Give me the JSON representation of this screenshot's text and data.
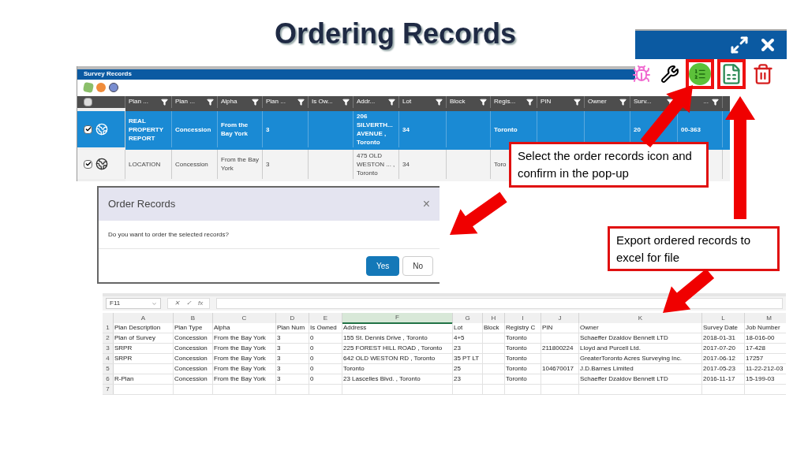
{
  "slide_title": "Ordering Records",
  "survey_records": {
    "title": "Survey Records",
    "header_checked": false,
    "columns": [
      "Plan ...",
      "Plan ...",
      "Alpha",
      "Plan ...",
      "Is Ow...",
      "Addr...",
      "Lot",
      "Block",
      "Regis...",
      "PIN",
      "Owner",
      "Surv...",
      "..."
    ],
    "rows": [
      {
        "selected": true,
        "checked": true,
        "cells": [
          "REAL PROPERTY REPORT",
          "Concession",
          "From the Bay York",
          "3",
          "",
          "206 SILVERTH... AVENUE , Toronto",
          "34",
          "",
          "Toronto",
          "",
          "",
          "20",
          "00-363"
        ]
      },
      {
        "selected": false,
        "checked": true,
        "cells": [
          "LOCATION",
          "Concession",
          "From the Bay York",
          "3",
          "",
          "475 OLD WESTON ... , Toronto",
          "34",
          "",
          "Toro",
          "",
          "",
          "",
          ""
        ]
      }
    ]
  },
  "toolbar": {
    "buttons": [
      {
        "kind": "bug",
        "highlighted": false
      },
      {
        "kind": "wrench",
        "highlighted": false
      },
      {
        "kind": "order",
        "highlighted": true
      },
      {
        "kind": "excel",
        "highlighted": true
      },
      {
        "kind": "trash",
        "highlighted": false
      }
    ]
  },
  "callouts": [
    {
      "text": "Select the order records icon and confirm in the pop-up"
    },
    {
      "text": "Export ordered records to excel for file"
    }
  ],
  "dialog": {
    "title": "Order Records",
    "close": "×",
    "message": "Do you want to order the selected records?",
    "buttons": [
      {
        "label": "Yes",
        "primary": true
      },
      {
        "label": "No",
        "primary": false
      }
    ]
  },
  "spreadsheet": {
    "name_box": "F11",
    "formula_buttons": [
      "✕",
      "✓",
      "fx"
    ],
    "columns": [
      "A",
      "B",
      "C",
      "D",
      "E",
      "F",
      "G",
      "H",
      "I",
      "J",
      "K",
      "L",
      "M"
    ],
    "rows": [
      {
        "number": "1",
        "cells": [
          "Plan Description",
          "Plan Type",
          "Alpha",
          "Plan Num",
          "Is Owned",
          "Address",
          "Lot",
          "Block",
          "Registry C",
          "PIN",
          "Owner",
          "Survey Date",
          "Job Number"
        ]
      },
      {
        "number": "2",
        "cells": [
          "Plan of Survey",
          "Concession",
          "From the Bay York",
          "3",
          "0",
          "155 St. Dennis Drive , Toronto",
          "4+5",
          "",
          "Toronto",
          "",
          "Schaeffer Dzaldov Bennett LTD",
          "2018-01-31",
          "18-016-00"
        ]
      },
      {
        "number": "3",
        "cells": [
          "SRPR",
          "Concession",
          "From the Bay York",
          "3",
          "0",
          "225 FOREST HILL ROAD , Toronto",
          "23",
          "",
          "Toronto",
          "211800224",
          "Lloyd and Purcell Ltd.",
          "2017-07-20",
          "17-428"
        ]
      },
      {
        "number": "4",
        "cells": [
          "SRPR",
          "Concession",
          "From the Bay York",
          "3",
          "0",
          "642 OLD WESTON RD , Toronto",
          "35 PT LT",
          "",
          "Toronto",
          "",
          "GreaterToronto Acres Surveying Inc.",
          "2017-06-12",
          "17257"
        ]
      },
      {
        "number": "5",
        "cells": [
          "",
          "Concession",
          "From the Bay York",
          "3",
          "0",
          "Toronto",
          "25",
          "",
          "Toronto",
          "104670017",
          "J.D.Barnes Limited",
          "2017-05-23",
          "11-22-212-03"
        ]
      },
      {
        "number": "6",
        "cells": [
          "R-Plan",
          "Concession",
          "From the Bay York",
          "3",
          "0",
          "23 Lascelles Blvd. , Toronto",
          "23",
          "",
          "Toronto",
          "",
          "Schaeffer Dzaldov Bennett LTD",
          "2016-11-17",
          "15-199-03"
        ]
      },
      {
        "number": "7",
        "cells": [
          "",
          "",
          "",
          "",
          "",
          "",
          "",
          "",
          "",
          "",
          "",
          "",
          ""
        ]
      }
    ]
  }
}
